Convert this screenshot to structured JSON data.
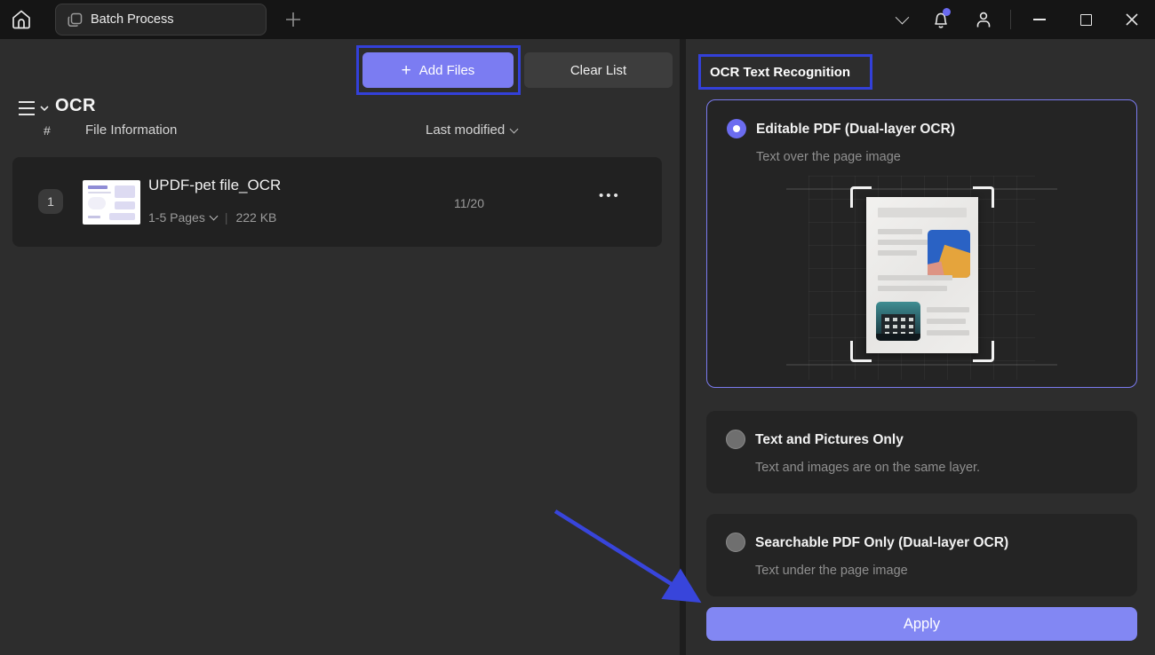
{
  "titlebar": {
    "tab_label": "Batch Process"
  },
  "left": {
    "title": "OCR",
    "add_files_label": "Add Files",
    "add_files_plus": "+",
    "clear_list_label": "Clear List",
    "columns": {
      "index": "#",
      "file_info": "File Information",
      "last_modified": "Last modified"
    },
    "file": {
      "index": "1",
      "name": "UPDF-pet file_OCR",
      "pages": "1-5 Pages",
      "separator": "|",
      "size": "222 KB",
      "modified": "11/20",
      "menu": "•••"
    }
  },
  "right": {
    "title": "OCR Text Recognition",
    "options": [
      {
        "label": "Editable PDF (Dual-layer OCR)",
        "desc": "Text over the page image",
        "selected": true
      },
      {
        "label": "Text and Pictures Only",
        "desc": "Text and images are on the same layer.",
        "selected": false
      },
      {
        "label": "Searchable PDF Only (Dual-layer OCR)",
        "desc": "Text under the page image",
        "selected": false
      }
    ],
    "apply_label": "Apply"
  },
  "colors": {
    "accent_purple": "#7b7cf2",
    "apply_purple": "#8287f3",
    "annotation_blue": "#3340d9",
    "arrow_blue": "#3845db",
    "notification_dot": "#6a6af0",
    "panel_bg": "#2d2d2d",
    "card_bg": "#242424",
    "titlebar_bg": "#151515",
    "selected_card_border": "#7b7bef"
  }
}
